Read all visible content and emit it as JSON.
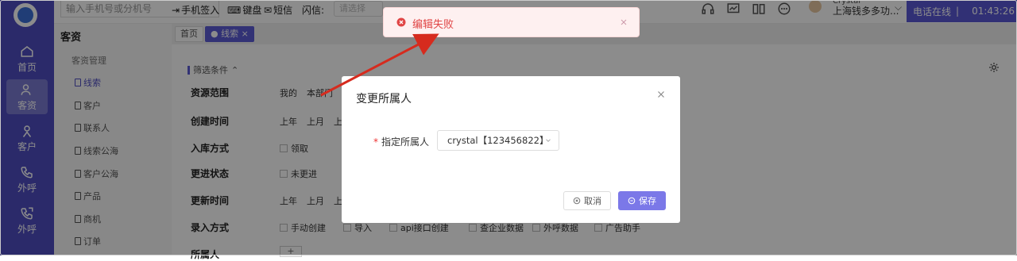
{
  "nav": {
    "items": [
      {
        "label": "首页",
        "icon": "home-icon"
      },
      {
        "label": "客资",
        "icon": "users-icon"
      },
      {
        "label": "客户",
        "icon": "user-icon"
      },
      {
        "label": "外呼",
        "icon": "phone-out-icon"
      },
      {
        "label": "外呼",
        "icon": "phone-call-icon"
      }
    ]
  },
  "topbar": {
    "search_placeholder": "输入手机号或分机号",
    "sign_in": "手机签入",
    "keyboard": "键盘",
    "sms": "短信",
    "flash_label": "闪信:",
    "flash_placeholder": "请选择",
    "user_name": "Crystal",
    "company": "上海钱多多功...",
    "phone_status": "电话在线",
    "timer": "01:43:26"
  },
  "subnav": {
    "title": "客资",
    "group": "客资管理",
    "items": [
      "线索",
      "客户",
      "联系人",
      "线索公海",
      "客户公海",
      "产品",
      "商机",
      "订单"
    ]
  },
  "tabs": {
    "home": "首页",
    "current": "线索",
    "current_close": "×"
  },
  "filters": {
    "header": "筛选条件",
    "rows": [
      {
        "label": "资源范围",
        "options": [
          "我的",
          "本部门"
        ]
      },
      {
        "label": "创建时间",
        "options": [
          "上年",
          "上月",
          "上"
        ]
      },
      {
        "label": "入库方式",
        "options": [
          "领取"
        ]
      },
      {
        "label": "更进状态",
        "options": [
          "未更进"
        ]
      },
      {
        "label": "更新时间",
        "options": [
          "上年",
          "上月",
          "上"
        ]
      },
      {
        "label": "录入方式",
        "options": [
          "手动创建",
          "导入",
          "api接口创建",
          "查企业数据",
          "外呼数据",
          "广告助手"
        ]
      },
      {
        "label": "所属人",
        "options": [
          "+"
        ]
      }
    ]
  },
  "modal": {
    "title": "变更所属人",
    "field_label": "指定所属人",
    "required_mark": "*",
    "selected_value": "crystal【123456822】",
    "cancel_label": "取消",
    "save_label": "保存"
  },
  "toast": {
    "message": "编辑失败",
    "status": "error"
  },
  "colors": {
    "brand": "#4f4ec2",
    "accent": "#7b78e8",
    "error": "#e04545",
    "annotation_arrow": "#d62b1e"
  }
}
